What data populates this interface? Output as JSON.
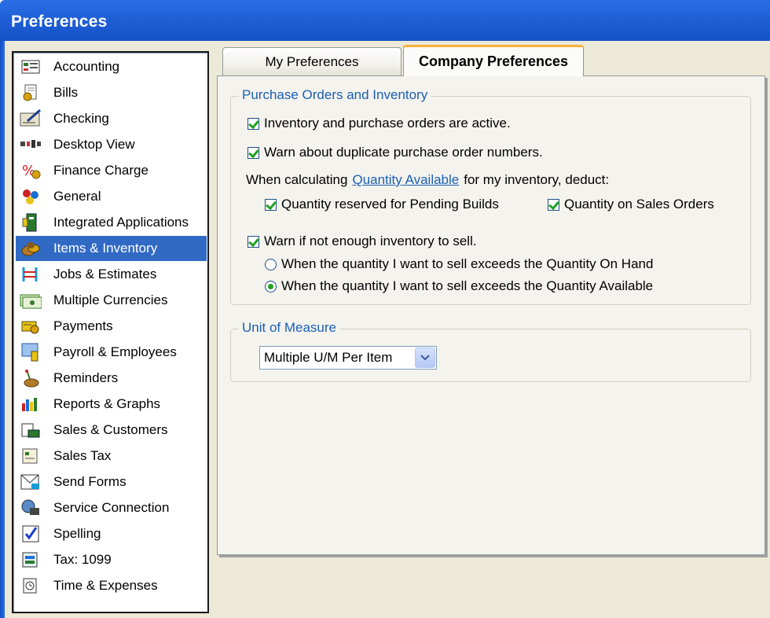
{
  "window": {
    "title": "Preferences"
  },
  "sidebar": {
    "items": [
      {
        "label": "Accounting",
        "icon": "accounting-icon",
        "selected": false
      },
      {
        "label": "Bills",
        "icon": "bills-icon",
        "selected": false
      },
      {
        "label": "Checking",
        "icon": "checking-icon",
        "selected": false
      },
      {
        "label": "Desktop View",
        "icon": "desktop-view-icon",
        "selected": false
      },
      {
        "label": "Finance Charge",
        "icon": "finance-charge-icon",
        "selected": false
      },
      {
        "label": "General",
        "icon": "general-icon",
        "selected": false
      },
      {
        "label": "Integrated Applications",
        "icon": "integrated-applications-icon",
        "selected": false
      },
      {
        "label": "Items & Inventory",
        "icon": "items-inventory-icon",
        "selected": true
      },
      {
        "label": "Jobs & Estimates",
        "icon": "jobs-estimates-icon",
        "selected": false
      },
      {
        "label": "Multiple Currencies",
        "icon": "multiple-currencies-icon",
        "selected": false
      },
      {
        "label": "Payments",
        "icon": "payments-icon",
        "selected": false
      },
      {
        "label": "Payroll & Employees",
        "icon": "payroll-employees-icon",
        "selected": false
      },
      {
        "label": "Reminders",
        "icon": "reminders-icon",
        "selected": false
      },
      {
        "label": "Reports & Graphs",
        "icon": "reports-graphs-icon",
        "selected": false
      },
      {
        "label": "Sales & Customers",
        "icon": "sales-customers-icon",
        "selected": false
      },
      {
        "label": "Sales Tax",
        "icon": "sales-tax-icon",
        "selected": false
      },
      {
        "label": "Send Forms",
        "icon": "send-forms-icon",
        "selected": false
      },
      {
        "label": "Service Connection",
        "icon": "service-connection-icon",
        "selected": false
      },
      {
        "label": "Spelling",
        "icon": "spelling-icon",
        "selected": false
      },
      {
        "label": "Tax: 1099",
        "icon": "tax-1099-icon",
        "selected": false
      },
      {
        "label": "Time & Expenses",
        "icon": "time-expenses-icon",
        "selected": false
      }
    ]
  },
  "tabs": {
    "my_preferences": "My Preferences",
    "company_preferences": "Company Preferences",
    "active": "company_preferences"
  },
  "purchase_orders": {
    "legend": "Purchase Orders and Inventory",
    "inventory_active": {
      "label": "Inventory and purchase orders are active.",
      "checked": true
    },
    "warn_duplicate": {
      "label": "Warn about duplicate purchase order numbers.",
      "checked": true
    },
    "calc_prefix": "When calculating",
    "calc_link": "Quantity Available",
    "calc_suffix": "for my inventory, deduct:",
    "pending_builds": {
      "label": "Quantity reserved for Pending Builds",
      "checked": true
    },
    "sales_orders": {
      "label": "Quantity on Sales Orders",
      "checked": true
    },
    "warn_not_enough": {
      "label": "Warn if not enough inventory to sell.",
      "checked": true
    },
    "radio_on_hand": {
      "label": "When the quantity I want to sell exceeds the Quantity On Hand",
      "selected": false
    },
    "radio_available": {
      "label": "When the quantity I want to sell exceeds the Quantity Available",
      "selected": true
    }
  },
  "unit_of_measure": {
    "legend": "Unit of Measure",
    "selected": "Multiple U/M Per Item"
  },
  "colors": {
    "titlebar": "#1f5fd6",
    "selection": "#316ac5",
    "legend_text": "#1a5fb4",
    "check_green": "#21a121",
    "active_tab_accent": "#f7b03b"
  }
}
